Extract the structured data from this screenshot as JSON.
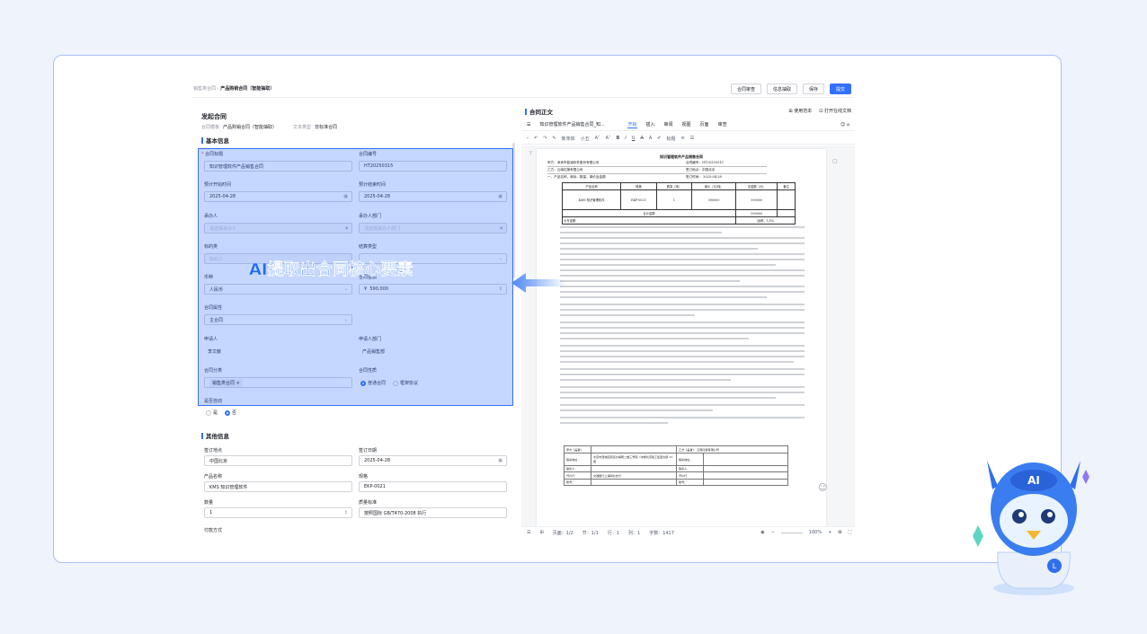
{
  "breadcrumb": {
    "root": "销售类合同",
    "sep": " › ",
    "current": "产品购销合同（智能抽取）"
  },
  "toolbar": {
    "review": "合同审查",
    "extract": "信息抽取",
    "save": "保存",
    "submit": "提交"
  },
  "form": {
    "title": "发起合同",
    "template_label": "合同模板",
    "template_value": "产品购销合同（智能抽取）",
    "text_type_label": "文本类型",
    "text_type_value": "非标准合同",
    "basic_section": "基本信息",
    "fields": {
      "contract_title": {
        "label": "合同标题",
        "value": "知识管理软件产品销售合同"
      },
      "contract_no": {
        "label": "合同编号",
        "value": "HT20250315"
      },
      "plan_start": {
        "label": "预计开始时间",
        "value": "2025-04-28"
      },
      "plan_end": {
        "label": "预计结束时间",
        "value": "2025-04-28"
      },
      "handler": {
        "label": "承办人",
        "placeholder": "请选择承办人"
      },
      "handler_dept": {
        "label": "承办人部门",
        "placeholder": "请选择承办人部门"
      },
      "object": {
        "label": "标的类",
        "placeholder": "标的人"
      },
      "settle_type": {
        "label": "结算类型",
        "placeholder": ""
      },
      "currency": {
        "label": "币种",
        "value": "人民币"
      },
      "amount": {
        "label": "合同金额",
        "prefix": "¥",
        "value": "590,000"
      },
      "attribute": {
        "label": "合同属性",
        "value": "主合同"
      },
      "applicant": {
        "label": "申请人",
        "value": "李文献"
      },
      "applicant_dept": {
        "label": "申请人部门",
        "value": "产品销售部"
      },
      "category": {
        "label": "合同分类",
        "value": "销售类合同"
      },
      "nature": {
        "label": "合同性质",
        "options": [
          "普通合同",
          "框架协议"
        ],
        "selected": "普通合同"
      },
      "auto_renew": {
        "label": "是否自动",
        "options": [
          "是",
          "否"
        ],
        "selected": "否"
      }
    },
    "other_section": "其他信息",
    "other": {
      "sign_place": {
        "label": "签订地点",
        "value": "中国北京"
      },
      "sign_date": {
        "label": "签订日期",
        "value": "2025-04-28"
      },
      "product_name": {
        "label": "产品名称",
        "value": "KMS 知识管理软件"
      },
      "spec": {
        "label": "规格",
        "value": "EKP-0021"
      },
      "quantity": {
        "label": "数量",
        "value": "1"
      },
      "quality": {
        "label": "质量标准",
        "value": "按照国际 GB/T470-2008 执行"
      },
      "more": "付款方式"
    }
  },
  "overlay_text": "AI提取出合同核心要素",
  "doc_panel": {
    "title": "合同正文",
    "links": [
      "使用范本",
      "打开在线文档"
    ],
    "doc_name": "知识管理软件产品销售合同_知...",
    "tabs": [
      "开始",
      "插入",
      "审阅",
      "视图",
      "页面",
      "审查"
    ],
    "active_tab": "开始",
    "format": {
      "font": "新宋体",
      "size": "小五",
      "title": "标题"
    },
    "paper": {
      "title": "知识管理软件产品销售合同",
      "party_a": "甲方：深圳市蓝凌软件股份有限公司",
      "contract_no": "合同编号：HT20250315",
      "party_b": "乙方：云南红旗有限公司",
      "sign_place": "签订地点：中国北京",
      "clause1": "一、产品名称、商标、数量、单价及金额",
      "sign_date": "签订时间： 2025-04-28",
      "table_head": [
        "产品名称",
        "规格",
        "数量（吨）",
        "单价（元/吨）",
        "总金额（元）",
        "备注"
      ],
      "table_row": [
        "KMS 知识管理软件",
        "EKP-0021",
        "1",
        "590000",
        "590000",
        ""
      ],
      "subtotal_label": "合计金额",
      "subtotal": "590000",
      "upper_label": "大写金额：",
      "upper_value": "（含税，13%）",
      "sign_a": "甲方（盖章）：",
      "sign_b": "乙方（盖章）：云南红旗有限公司",
      "addr_label": "联系地址：",
      "addr_value": "北京市西城区街道大胡同二楼三号院（中燃北京建工集团大厦 22 层",
      "addr_b": "联系地址：",
      "contact": "联系人：",
      "contact_b": "联系人：",
      "bank": "开户行：",
      "bank_value": "交通银行上海闸北支行",
      "bank_b": "开户行：",
      "acct": "账号：",
      "acct_b": "账号："
    },
    "status": {
      "page": "页面：1/2",
      "section": "节：1/1",
      "row": "行：1",
      "col": "列：1",
      "words": "字数：1417",
      "zoom": "100%"
    }
  }
}
